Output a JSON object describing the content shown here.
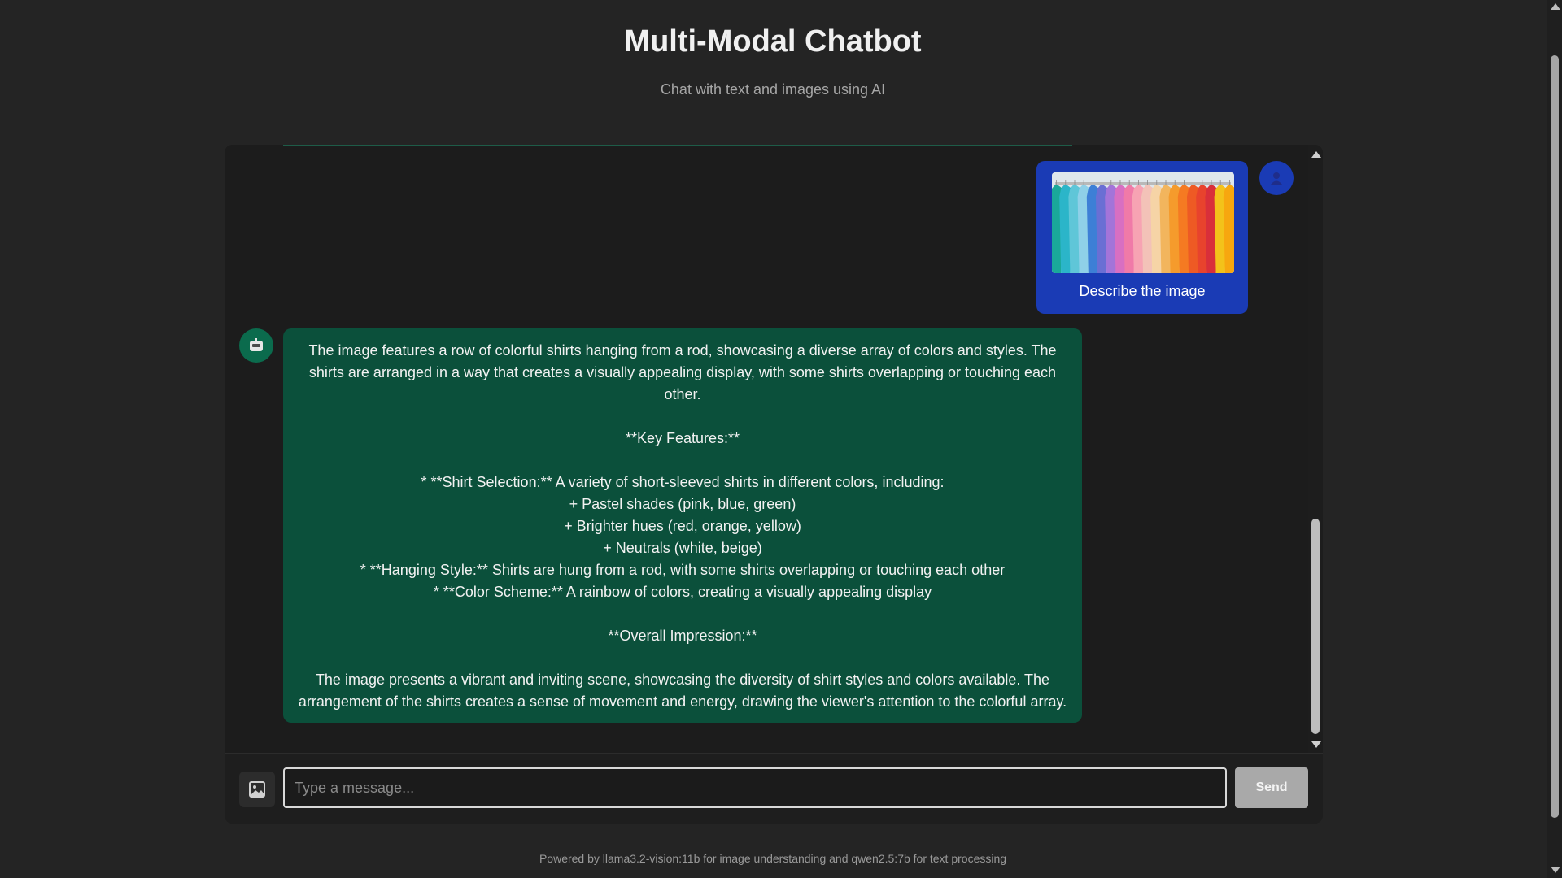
{
  "header": {
    "title": "Multi-Modal Chatbot",
    "subtitle": "Chat with text and images using AI"
  },
  "messages": [
    {
      "role": "user",
      "image": "colorful-shirts-on-rack",
      "text": "Describe the image"
    },
    {
      "role": "assistant",
      "lines": [
        "The image features a row of colorful shirts hanging from a rod, showcasing a diverse array of colors and styles. The",
        "shirts are arranged in a way that creates a visually appealing display, with some shirts overlapping or touching each",
        "other.",
        "",
        "**Key Features:**",
        "",
        "* **Shirt Selection:** A variety of short-sleeved shirts in different colors, including:",
        "+ Pastel shades (pink, blue, green)",
        "+ Brighter hues (red, orange, yellow)",
        "+ Neutrals (white, beige)",
        "* **Hanging Style:** Shirts are hung from a rod, with some shirts overlapping or touching each other",
        "* **Color Scheme:** A rainbow of colors, creating a visually appealing display",
        "",
        "**Overall Impression:**",
        "",
        "The image presents a vibrant and inviting scene, showcasing the diversity of shirt styles and colors available. The",
        "arrangement of the shirts creates a sense of movement and energy, drawing the viewer's attention to the colorful array."
      ]
    }
  ],
  "input": {
    "placeholder": "Type a message...",
    "value": "",
    "send_label": "Send",
    "upload_icon": "image-icon"
  },
  "footer": {
    "text": "Powered by llama3.2-vision:11b for image understanding and qwen2.5:7b for text processing"
  },
  "colors": {
    "background": "#242424",
    "user_bubble": "#1a3bb5",
    "assistant_bubble": "#0b503b",
    "assistant_avatar": "#0b6b4d",
    "send_button": "#a9a9a9"
  }
}
